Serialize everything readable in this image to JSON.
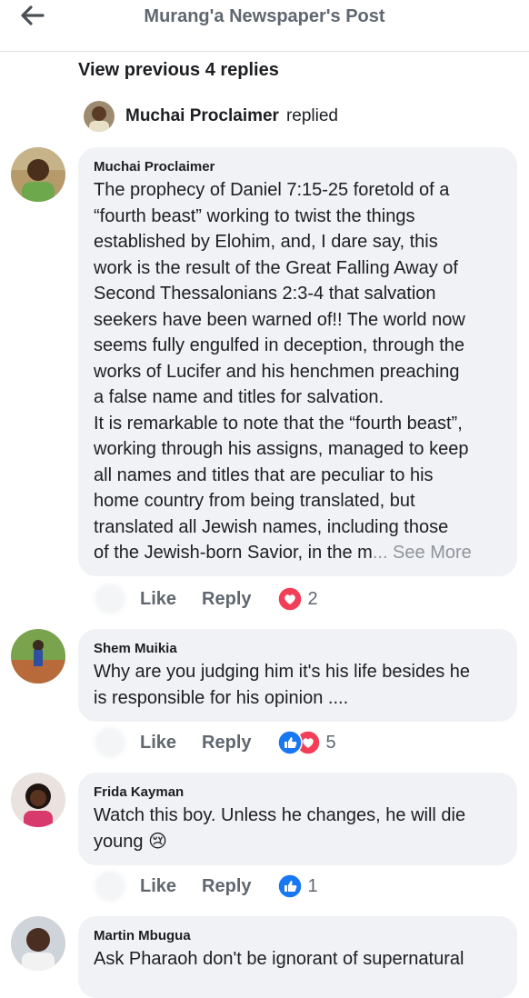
{
  "header": {
    "title": "Murang'a Newspaper's Post",
    "back_icon": "arrow-left-icon"
  },
  "thread": {
    "view_previous_label": "View previous 4 replies",
    "reply_summary": {
      "name": "Muchai Proclaimer",
      "verb": "replied"
    }
  },
  "comments": [
    {
      "author": "Muchai Proclaimer",
      "lines": [
        "The prophecy of Daniel 7:15-25 foretold of a",
        "“fourth beast” working to twist the things",
        "established by Elohim, and, I dare say, this",
        "work is the result of the Great Falling Away of",
        "Second Thessalonians 2:3-4 that salvation",
        "seekers have been warned of!! The world now",
        "seems fully engulfed in deception, through the",
        "works of Lucifer and his henchmen preaching",
        "a false name and titles for salvation.",
        "It is remarkable to note that the “fourth beast”,",
        "working through his assigns, managed to keep",
        "all names and titles that are peculiar to his",
        "home country from being translated, but",
        "translated all Jewish names, including those",
        "of the Jewish-born Savior, in the m"
      ],
      "see_more": "... See More",
      "like_label": "Like",
      "reply_label": "Reply",
      "reactions": [
        "love"
      ],
      "reaction_count": "2"
    },
    {
      "author": "Shem Muikia",
      "lines": [
        "Why are you judging him it's his life besides he",
        "is responsible for his opinion ...."
      ],
      "like_label": "Like",
      "reply_label": "Reply",
      "reactions": [
        "like",
        "love"
      ],
      "reaction_count": "5"
    },
    {
      "author": "Frida Kayman",
      "lines": [
        "Watch this boy. Unless he changes,  he will die",
        "young"
      ],
      "emoji": "😢",
      "like_label": "Like",
      "reply_label": "Reply",
      "reactions": [
        "like"
      ],
      "reaction_count": "1"
    },
    {
      "author": "Martin Mbugua",
      "lines": [
        "Ask Pharaoh  don't be ignorant of supernatural"
      ]
    }
  ],
  "colors": {
    "like_blue": "#1877f2",
    "love_red": "#f33e58",
    "bubble_bg": "#f0f2f5",
    "muted_text": "#606770"
  }
}
